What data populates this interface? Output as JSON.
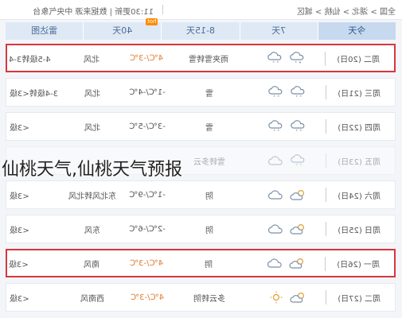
{
  "topbar": {
    "breadcrumb": "全国 > 湖北 > 仙桃 > 城区",
    "timeinfo": "11:30更新 | 数据来源 中央气象台"
  },
  "tabs": [
    {
      "label": "今天"
    },
    {
      "label": "7天"
    },
    {
      "label": "8-15天"
    },
    {
      "label": "40天",
      "badge": "hot"
    },
    {
      "label": "雷达图"
    }
  ],
  "rows": [
    {
      "date": "周二 (20日)",
      "weather": "雨夹雪转雪",
      "temp": "4℃/-3℃",
      "wind": "北风",
      "level": "4-5级转3-4",
      "icons": [
        "sleet",
        "snow"
      ],
      "highlight": true
    },
    {
      "date": "周三 (21日)",
      "weather": "雪",
      "temp": "-1℃/-4℃",
      "wind": "北风",
      "level": "3-4级转<3级",
      "icons": [
        "snow",
        "snow"
      ]
    },
    {
      "date": "周四 (22日)",
      "weather": "雪",
      "temp": "-3℃/-5℃",
      "wind": "北风",
      "level": "<3级",
      "icons": [
        "snow",
        "snow"
      ]
    },
    {
      "date": "周五 (23日)",
      "weather": "雪转多云",
      "temp": "",
      "wind": "",
      "level": "",
      "icons": [
        "snow",
        "cloud"
      ],
      "faded": true
    },
    {
      "date": "周六 (24日)",
      "weather": "阴",
      "temp": "-1℃/-9℃",
      "wind": "东北风转北风",
      "level": "<3级",
      "icons": [
        "partly",
        "cloud"
      ]
    },
    {
      "date": "周日 (25日)",
      "weather": "阴",
      "temp": "-2℃/-6℃",
      "wind": "东风",
      "level": "<3级",
      "icons": [
        "partly",
        "cloud"
      ]
    },
    {
      "date": "周一 (26日)",
      "weather": "阴",
      "temp": "4℃/-3℃",
      "wind": "南风",
      "level": "<3级",
      "icons": [
        "partly",
        "cloud"
      ],
      "highlight": true
    },
    {
      "date": "周二 (27日)",
      "weather": "多云转阴",
      "temp": "4℃/-3℃",
      "wind": "西南风",
      "level": "<3级",
      "icons": [
        "partly",
        "sun"
      ]
    }
  ],
  "overlay_text": "仙桃天气,仙桃天气预报"
}
